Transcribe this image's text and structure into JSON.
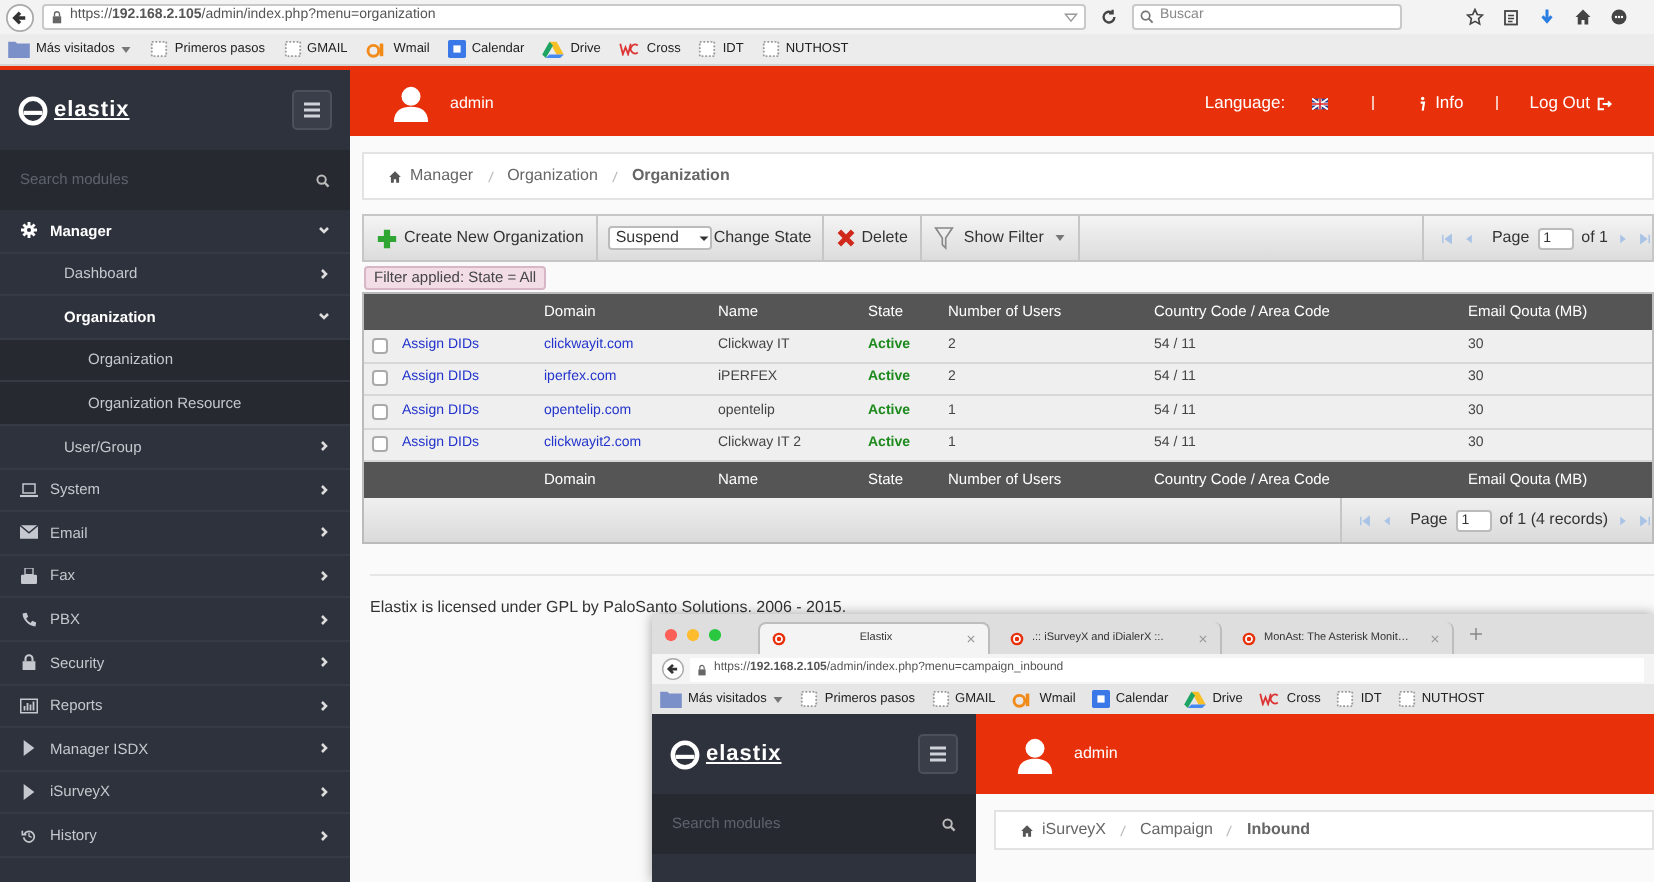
{
  "browser": {
    "url": "https://**192.168.2.105**/admin/index.php?menu=organization",
    "search_placeholder": "Buscar",
    "bookmarks": [
      "Más visitados",
      "Primeros pasos",
      "GMAIL",
      "Wmail",
      "Calendar",
      "Drive",
      "Cross",
      "IDT",
      "NUTHOST"
    ]
  },
  "sidebar": {
    "logo": "elastix",
    "search_placeholder": "Search modules",
    "items": [
      {
        "label": "Manager",
        "expanded": true,
        "children": [
          {
            "label": "Dashboard",
            "expanded": false
          },
          {
            "label": "Organization",
            "expanded": true,
            "children": [
              {
                "label": "Organization"
              },
              {
                "label": "Organization Resource"
              }
            ]
          },
          {
            "label": "User/Group",
            "expanded": false
          }
        ]
      },
      {
        "label": "System",
        "expanded": false
      },
      {
        "label": "Email",
        "expanded": false
      },
      {
        "label": "Fax",
        "expanded": false
      },
      {
        "label": "PBX",
        "expanded": false
      },
      {
        "label": "Security",
        "expanded": false
      },
      {
        "label": "Reports",
        "expanded": false
      },
      {
        "label": "Manager ISDX",
        "expanded": false
      },
      {
        "label": "iSurveyX",
        "expanded": false
      },
      {
        "label": "History",
        "expanded": false
      }
    ]
  },
  "header": {
    "user": "admin",
    "language_label": "Language:",
    "info": "Info",
    "logout": "Log Out"
  },
  "breadcrumb": [
    "Manager",
    "Organization",
    "Organization"
  ],
  "toolbar": {
    "create": "Create New Organization",
    "state_select": "Suspend",
    "change_state": "Change State",
    "delete": "Delete",
    "show_filter": "Show Filter",
    "page_label": "Page",
    "page_value": "1",
    "page_total": "of 1"
  },
  "filter_applied": "Filter applied: State = All",
  "table": {
    "columns": [
      "Domain",
      "Name",
      "State",
      "Number of Users",
      "Country Code / Area Code",
      "Email Qouta (MB)"
    ],
    "rows": [
      {
        "checked": false,
        "action": "Assign DIDs",
        "domain": "clickwayit.com",
        "name": "Clickway IT",
        "state": "Active",
        "users": "2",
        "code": "54 / 11",
        "quota": "30"
      },
      {
        "checked": false,
        "action": "Assign DIDs",
        "domain": "iperfex.com",
        "name": "iPERFEX",
        "state": "Active",
        "users": "2",
        "code": "54 / 11",
        "quota": "30"
      },
      {
        "checked": false,
        "action": "Assign DIDs",
        "domain": "opentelip.com",
        "name": "opentelip",
        "state": "Active",
        "users": "1",
        "code": "54 / 11",
        "quota": "30"
      },
      {
        "checked": false,
        "action": "Assign DIDs",
        "domain": "clickwayit2.com",
        "name": "Clickway IT 2",
        "state": "Active",
        "users": "1",
        "code": "54 / 11",
        "quota": "30"
      }
    ],
    "footer_columns": [
      "Domain",
      "Name",
      "State",
      "Number of Users",
      "Country Code / Area Code",
      "Email Qouta (MB)"
    ],
    "pager": {
      "label": "Page",
      "value": "1",
      "total": "of 1 (4 records)"
    }
  },
  "license": "Elastix is licensed under GPL by PaloSanto Solutions. 2006 - 2015.",
  "overlay_window": {
    "tabs": [
      {
        "title": "Elastix",
        "selected": true
      },
      {
        "title": ".:: iSurveyX and iDialerX ::.",
        "selected": false
      },
      {
        "title": "MonAst: The Asterisk Monit…",
        "selected": false
      }
    ],
    "url": "https://**192.168.2.105**/admin/index.php?menu=campaign_inbound",
    "bookmarks": [
      "Más visitados",
      "Primeros pasos",
      "GMAIL",
      "Wmail",
      "Calendar",
      "Drive",
      "Cross",
      "IDT",
      "NUTHOST"
    ],
    "logo": "elastix",
    "search_placeholder": "Search modules",
    "user": "admin",
    "breadcrumb": [
      "iSurveyX",
      "Campaign",
      "Inbound"
    ]
  }
}
